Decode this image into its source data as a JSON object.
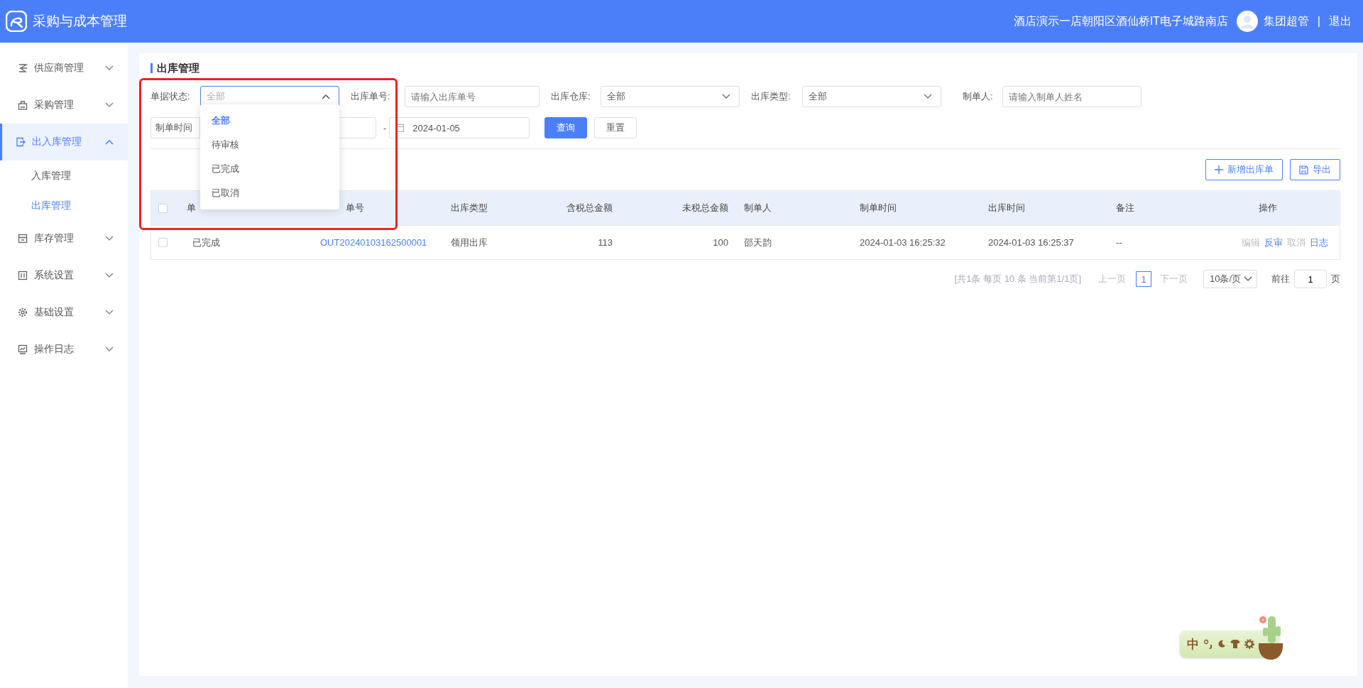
{
  "header": {
    "title": "采购与成本管理",
    "store": "酒店演示一店朝阳区酒仙桥IT电子城路南店",
    "user": "集团超管",
    "separator": "|",
    "logout": "退出"
  },
  "sidebar": {
    "items": [
      {
        "label": "供应商管理",
        "selected": false,
        "expanded": false
      },
      {
        "label": "采购管理",
        "selected": false,
        "expanded": false
      },
      {
        "label": "出入库管理",
        "selected": true,
        "expanded": true,
        "children": [
          {
            "label": "入库管理",
            "selected": false
          },
          {
            "label": "出库管理",
            "selected": true
          }
        ]
      },
      {
        "label": "库存管理",
        "selected": false,
        "expanded": false
      },
      {
        "label": "系统设置",
        "selected": false,
        "expanded": false
      },
      {
        "label": "基础设置",
        "selected": false,
        "expanded": false
      },
      {
        "label": "操作日志",
        "selected": false,
        "expanded": false
      }
    ]
  },
  "page": {
    "title": "出库管理"
  },
  "filters": [
    {
      "kind": "select",
      "label": "单据状态:",
      "placeholder": "全部",
      "open": true
    },
    {
      "kind": "input",
      "label": "出库单号:",
      "placeholder": "请输入出库单号"
    },
    {
      "kind": "select",
      "label": "出库仓库:",
      "value": "全部",
      "open": false
    },
    {
      "kind": "select",
      "label": "出库类型:",
      "value": "全部",
      "open": false
    },
    {
      "kind": "input",
      "label": "制单人:",
      "placeholder": "请输入制单人姓名"
    }
  ],
  "date_range": {
    "label": "制单时间",
    "separator": "-",
    "end": "2024-01-05"
  },
  "buttons": [
    {
      "label": "查询",
      "primary": true
    },
    {
      "label": "重置",
      "primary": false
    }
  ],
  "status_dropdown": {
    "options": [
      {
        "label": "全部",
        "selected": true
      },
      {
        "label": "待审核",
        "selected": false
      },
      {
        "label": "已完成",
        "selected": false
      },
      {
        "label": "已取消",
        "selected": false
      }
    ]
  },
  "toolbar": [
    {
      "kind": "add",
      "label": "新增出库单"
    },
    {
      "kind": "export",
      "label": "导出"
    }
  ],
  "table": {
    "select_all": false,
    "columns": [
      "单",
      "单号",
      "出库类型",
      "含税总金额",
      "未税总金额",
      "制单人",
      "制单时间",
      "出库时间",
      "备注",
      "操作"
    ],
    "rows": [
      {
        "checked": false,
        "cells": [
          "已完成",
          "OUT20240103162500001",
          "领用出库",
          "113",
          "100",
          "邵天韵",
          "2024-01-03 16:25:32",
          "2024-01-03 16:25:37",
          "--"
        ],
        "actions": [
          {
            "label": "编辑",
            "disabled": true
          },
          {
            "label": "反审",
            "disabled": false
          },
          {
            "label": "取消",
            "disabled": true
          },
          {
            "label": "日志",
            "disabled": false
          }
        ]
      }
    ]
  },
  "pagination": {
    "summary": "[共1条 每页 10 条 当前第1/1页]",
    "prev": {
      "label": "上一页",
      "disabled": true
    },
    "pages": [
      {
        "label": "1",
        "selected": true
      }
    ],
    "next": {
      "label": "下一页",
      "disabled": true
    },
    "page_size": "10条/页",
    "goto_label": "前往",
    "goto_value": "1",
    "goto_suffix": "页"
  },
  "ime": {
    "mode": "中"
  }
}
